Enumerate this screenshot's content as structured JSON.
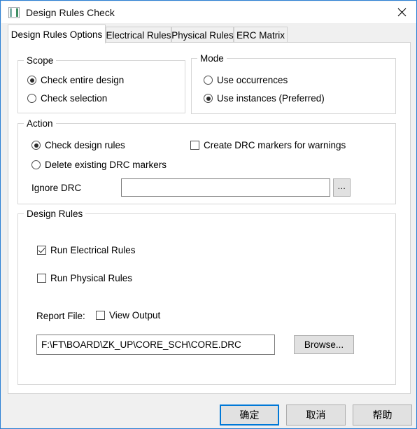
{
  "window": {
    "title": "Design Rules Check",
    "icon": "application-icon",
    "close_icon": "close-icon",
    "accent_color": "#0078d7",
    "border_color": "#2a7fd4"
  },
  "tabs": [
    {
      "label": "Design Rules Options",
      "active": true
    },
    {
      "label": "Electrical Rules",
      "active": false
    },
    {
      "label": "Physical Rules",
      "active": false
    },
    {
      "label": "ERC Matrix",
      "active": false
    }
  ],
  "scope": {
    "legend": "Scope",
    "options": [
      {
        "label": "Check entire design",
        "selected": true
      },
      {
        "label": "Check selection",
        "selected": false
      }
    ]
  },
  "mode": {
    "legend": "Mode",
    "options": [
      {
        "label": "Use occurrences",
        "selected": false
      },
      {
        "label": "Use instances (Preferred)",
        "selected": true
      }
    ]
  },
  "action": {
    "legend": "Action",
    "options": [
      {
        "label": "Check design rules",
        "selected": true
      },
      {
        "label": "Delete existing DRC markers",
        "selected": false
      }
    ],
    "create_markers": {
      "label": "Create DRC markers for warnings",
      "checked": false
    },
    "ignore_drc": {
      "label": "Ignore DRC",
      "value": "",
      "placeholder": "",
      "browse_label": "..."
    }
  },
  "design_rules": {
    "legend": "Design Rules",
    "checks": [
      {
        "label": "Run Electrical Rules",
        "checked": true
      },
      {
        "label": "Run Physical Rules",
        "checked": false
      }
    ],
    "report": {
      "label": "Report File:",
      "view_output": {
        "label": "View Output",
        "checked": false
      },
      "path": "F:\\FT\\BOARD\\ZK_UP\\CORE_SCH\\CORE.DRC",
      "browse_label": "Browse..."
    }
  },
  "footer": {
    "ok_label": "确定",
    "cancel_label": "取消",
    "help_label": "帮助"
  }
}
